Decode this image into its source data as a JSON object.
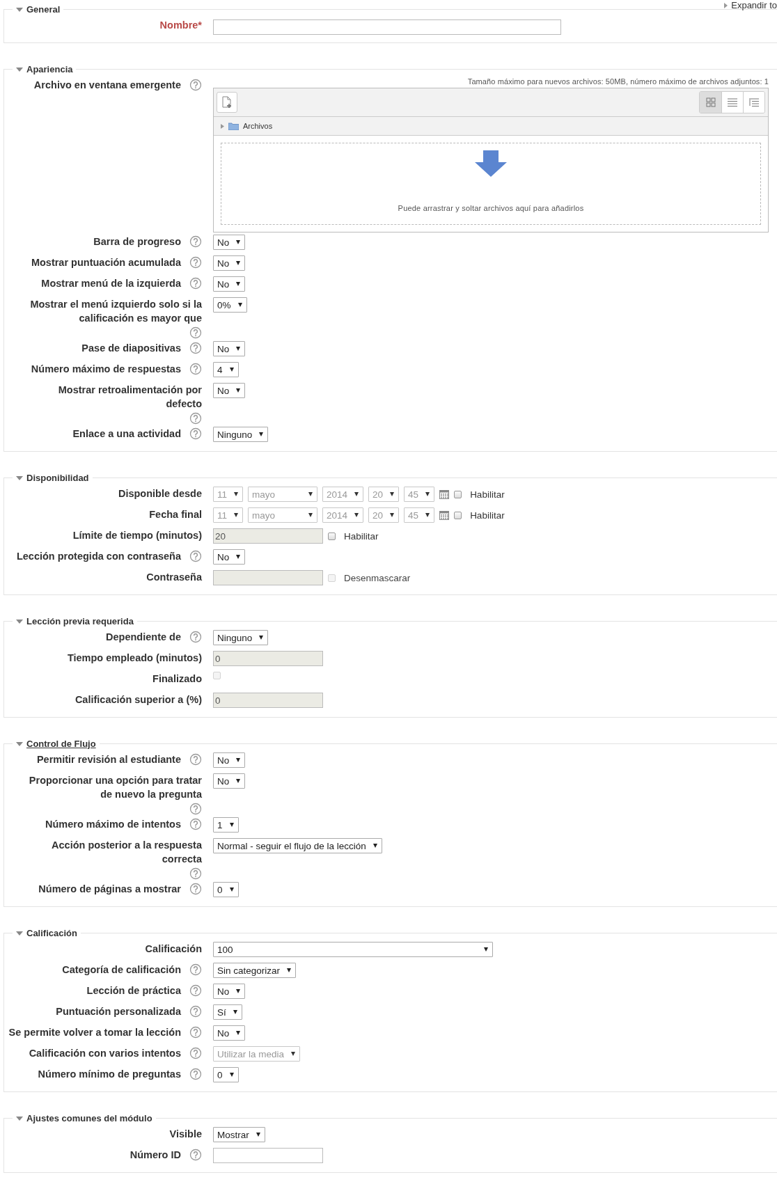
{
  "expand_all_link": "Expandir to",
  "sections": [
    {
      "title": "General",
      "expanded": true,
      "link": false,
      "fields": [
        {
          "label": "Nombre",
          "required_mark": "*",
          "help": false,
          "controls": [
            {
              "kind": "long-text",
              "disabled": false
            }
          ]
        }
      ]
    },
    {
      "title": "Apariencia",
      "expanded": true,
      "link": false,
      "fields": [
        {
          "label": "Archivo en ventana emergente",
          "help": true,
          "controls": [
            {
              "kind": "filepicker",
              "note": "Tamaño máximo para nuevos archivos: 50MB, número máximo de archivos adjuntos: 1",
              "folder": "Archivos",
              "drop_text": "Puede arrastrar y soltar archivos aquí para añadirlos",
              "views": [
                {
                  "selected": true
                },
                {
                  "selected": false
                },
                {
                  "selected": false
                }
              ]
            }
          ]
        },
        {
          "label": "Barra de progreso",
          "help": true,
          "controls": [
            {
              "kind": "select",
              "value": "No",
              "disabled": false
            }
          ]
        },
        {
          "label": "Mostrar puntuación acumulada",
          "help": true,
          "controls": [
            {
              "kind": "select",
              "value": "No",
              "disabled": false
            }
          ]
        },
        {
          "label": "Mostrar menú de la izquierda",
          "help": true,
          "controls": [
            {
              "kind": "select",
              "value": "No",
              "disabled": false
            }
          ]
        },
        {
          "label": "Mostrar el menú izquierdo solo si la calificación es mayor que",
          "help": true,
          "controls": [
            {
              "kind": "select",
              "value": "0%",
              "disabled": false
            }
          ]
        },
        {
          "label": "Pase de diapositivas",
          "help": true,
          "controls": [
            {
              "kind": "select",
              "value": "No",
              "disabled": false
            }
          ]
        },
        {
          "label": "Número máximo de respuestas",
          "help": true,
          "controls": [
            {
              "kind": "select",
              "value": "4",
              "disabled": false
            }
          ]
        },
        {
          "label": "Mostrar retroalimentación por defecto",
          "help": true,
          "controls": [
            {
              "kind": "select",
              "value": "No",
              "disabled": false
            }
          ]
        },
        {
          "label": "Enlace a una actividad",
          "help": true,
          "controls": [
            {
              "kind": "select",
              "value": "Ninguno",
              "disabled": false
            }
          ]
        }
      ]
    },
    {
      "title": "Disponibilidad",
      "expanded": true,
      "link": false,
      "fields": [
        {
          "label": "Disponible desde",
          "help": false,
          "controls": [
            {
              "kind": "select",
              "value": "11",
              "disabled": true
            },
            {
              "kind": "month-select",
              "value": "mayo",
              "disabled": true
            },
            {
              "kind": "select",
              "value": "2014",
              "disabled": true
            },
            {
              "kind": "select",
              "value": "20",
              "disabled": true
            },
            {
              "kind": "select",
              "value": "45",
              "disabled": true
            },
            {
              "kind": "calendar"
            },
            {
              "kind": "checkbox",
              "checked": false,
              "disabled": false,
              "label": "Habilitar"
            }
          ]
        },
        {
          "label": "Fecha final",
          "help": false,
          "controls": [
            {
              "kind": "select",
              "value": "11",
              "disabled": true
            },
            {
              "kind": "month-select",
              "value": "mayo",
              "disabled": true
            },
            {
              "kind": "select",
              "value": "2014",
              "disabled": true
            },
            {
              "kind": "select",
              "value": "20",
              "disabled": true
            },
            {
              "kind": "select",
              "value": "45",
              "disabled": true
            },
            {
              "kind": "calendar"
            },
            {
              "kind": "checkbox",
              "checked": false,
              "disabled": false,
              "label": "Habilitar"
            }
          ]
        },
        {
          "label": "Límite de tiempo (minutos)",
          "help": false,
          "controls": [
            {
              "kind": "text",
              "value": "20",
              "disabled": true
            },
            {
              "kind": "checkbox",
              "checked": false,
              "disabled": false,
              "label": "Habilitar"
            }
          ]
        },
        {
          "label": "Lección protegida con contraseña",
          "help": true,
          "controls": [
            {
              "kind": "select",
              "value": "No",
              "disabled": false
            }
          ]
        },
        {
          "label": "Contraseña",
          "help": false,
          "controls": [
            {
              "kind": "text",
              "disabled": true
            },
            {
              "kind": "checkbox",
              "checked": false,
              "disabled": true,
              "label": "Desenmascarar"
            }
          ]
        }
      ]
    },
    {
      "title": "Lección previa requerida",
      "expanded": true,
      "link": false,
      "fields": [
        {
          "label": "Dependiente de",
          "help": true,
          "controls": [
            {
              "kind": "select",
              "value": "Ninguno",
              "disabled": false
            }
          ]
        },
        {
          "label": "Tiempo empleado (minutos)",
          "help": false,
          "controls": [
            {
              "kind": "text",
              "value": "0",
              "disabled": true
            }
          ]
        },
        {
          "label": "Finalizado",
          "help": false,
          "controls": [
            {
              "kind": "checkbox",
              "checked": false,
              "disabled": true
            }
          ]
        },
        {
          "label": "Calificación superior a (%)",
          "help": false,
          "controls": [
            {
              "kind": "text",
              "value": "0",
              "disabled": true
            }
          ]
        }
      ]
    },
    {
      "title": "Control de Flujo",
      "expanded": true,
      "link": true,
      "fields": [
        {
          "label": "Permitir revisión al estudiante",
          "help": true,
          "controls": [
            {
              "kind": "select",
              "value": "No",
              "disabled": false
            }
          ]
        },
        {
          "label": "Proporcionar una opción para tratar de nuevo la pregunta",
          "help": true,
          "controls": [
            {
              "kind": "select",
              "value": "No",
              "disabled": false
            }
          ]
        },
        {
          "label": "Número máximo de intentos",
          "help": true,
          "controls": [
            {
              "kind": "select",
              "value": "1",
              "disabled": false
            }
          ]
        },
        {
          "label": "Acción posterior a la respuesta correcta",
          "help": true,
          "controls": [
            {
              "kind": "select",
              "value": "Normal - seguir el flujo de la lección",
              "disabled": false
            }
          ]
        },
        {
          "label": "Número de páginas a mostrar",
          "help": true,
          "controls": [
            {
              "kind": "select",
              "value": "0",
              "disabled": false
            }
          ]
        }
      ]
    },
    {
      "title": "Calificación",
      "expanded": true,
      "link": false,
      "fields": [
        {
          "label": "Calificación",
          "help": false,
          "controls": [
            {
              "kind": "wide-select",
              "value": "100",
              "disabled": false
            }
          ]
        },
        {
          "label": "Categoría de calificación",
          "help": true,
          "controls": [
            {
              "kind": "select",
              "value": "Sin categorizar",
              "disabled": false
            }
          ]
        },
        {
          "label": "Lección de práctica",
          "help": true,
          "controls": [
            {
              "kind": "select",
              "value": "No",
              "disabled": false
            }
          ]
        },
        {
          "label": "Puntuación personalizada",
          "help": true,
          "controls": [
            {
              "kind": "select",
              "value": "Sí",
              "disabled": false
            }
          ]
        },
        {
          "label": "Se permite volver a tomar la lección",
          "help": true,
          "controls": [
            {
              "kind": "select",
              "value": "No",
              "disabled": false
            }
          ]
        },
        {
          "label": "Calificación con varios intentos",
          "help": true,
          "controls": [
            {
              "kind": "select",
              "value": "Utilizar la media",
              "disabled": true
            }
          ]
        },
        {
          "label": "Número mínimo de preguntas",
          "help": true,
          "controls": [
            {
              "kind": "select",
              "value": "0",
              "disabled": false
            }
          ]
        }
      ]
    },
    {
      "title": "Ajustes comunes del módulo",
      "expanded": true,
      "link": false,
      "fields": [
        {
          "label": "Visible",
          "help": false,
          "controls": [
            {
              "kind": "select",
              "value": "Mostrar",
              "disabled": false
            }
          ]
        },
        {
          "label": "Número ID",
          "help": true,
          "controls": [
            {
              "kind": "text",
              "disabled": false
            }
          ]
        }
      ]
    }
  ]
}
